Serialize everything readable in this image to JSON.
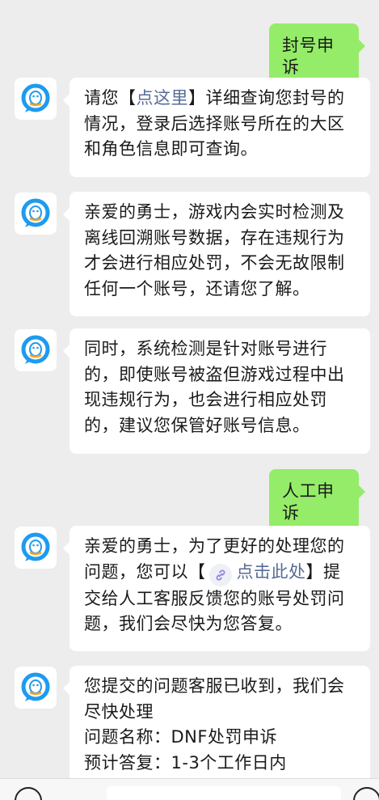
{
  "messages": [
    {
      "from": "user",
      "text": "封号申诉"
    },
    {
      "from": "bot",
      "pre": "请您【",
      "link": "点这里",
      "post_first": "】详细查询您封号的",
      "lines": [
        "情况，登录后选择账号所在的大区",
        "和角色信息即可查询。"
      ]
    },
    {
      "from": "bot",
      "lines": [
        "亲爱的勇士，游戏内会实时检测及",
        "离线回溯账号数据，存在违规行为",
        "才会进行相应处罚，不会无故限制",
        "任何一个账号，还请您了解。"
      ]
    },
    {
      "from": "bot",
      "lines": [
        "同时，系统检测是针对账号进行",
        "的，即使账号被盗但游戏过程中出",
        "现违规行为，也会进行相应处罚",
        "的，建议您保管好账号信息。"
      ]
    },
    {
      "from": "user",
      "text": "人工申诉"
    },
    {
      "from": "bot",
      "line1": "亲爱的勇士，为了更好的处理您的",
      "pre": "问题，您可以【",
      "link": "点击此处",
      "post": "】提",
      "lines": [
        "交给人工客服反馈您的账号处罚问",
        "题，我们会尽快为您答复。"
      ]
    },
    {
      "from": "bot",
      "lines": [
        "您提交的问题客服已收到，我们会",
        "尽快处理",
        "问题名称：DNF处罚申诉",
        "预计答复：1-3个工作日内"
      ]
    }
  ],
  "icons": {
    "avatar": "qq-service-avatar-icon",
    "link": "link-icon",
    "voice": "voice-icon",
    "plus": "plus-icon"
  },
  "colors": {
    "background": "#ededed",
    "bot_bubble": "#ffffff",
    "user_bubble": "#95ec69",
    "link": "#576b95",
    "avatar_blue": "#1e9bf0"
  }
}
